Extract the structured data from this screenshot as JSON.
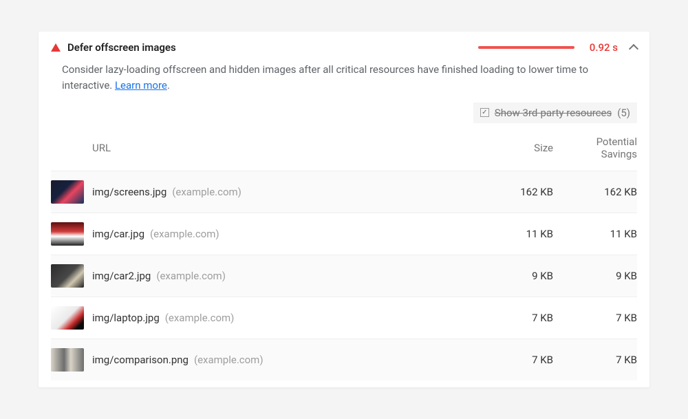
{
  "audit": {
    "title": "Defer offscreen images",
    "metric": "0.92 s",
    "description_pre": "Consider lazy-loading offscreen and hidden images after all critical resources have finished loading to lower time to interactive. ",
    "learn_more": "Learn more",
    "description_post": "."
  },
  "third_party": {
    "label": "Show 3rd-party resources",
    "count": "(5)",
    "checked": true
  },
  "columns": {
    "url": "URL",
    "size": "Size",
    "savings": "Potential Savings"
  },
  "rows": [
    {
      "thumb": "t-screens",
      "path": "img/screens.jpg",
      "origin": "(example.com)",
      "size": "162 KB",
      "savings": "162 KB"
    },
    {
      "thumb": "t-car",
      "path": "img/car.jpg",
      "origin": "(example.com)",
      "size": "11 KB",
      "savings": "11 KB"
    },
    {
      "thumb": "t-car2",
      "path": "img/car2.jpg",
      "origin": "(example.com)",
      "size": "9 KB",
      "savings": "9 KB"
    },
    {
      "thumb": "t-laptop",
      "path": "img/laptop.jpg",
      "origin": "(example.com)",
      "size": "7 KB",
      "savings": "7 KB"
    },
    {
      "thumb": "t-compare",
      "path": "img/comparison.png",
      "origin": "(example.com)",
      "size": "7 KB",
      "savings": "7 KB"
    }
  ]
}
